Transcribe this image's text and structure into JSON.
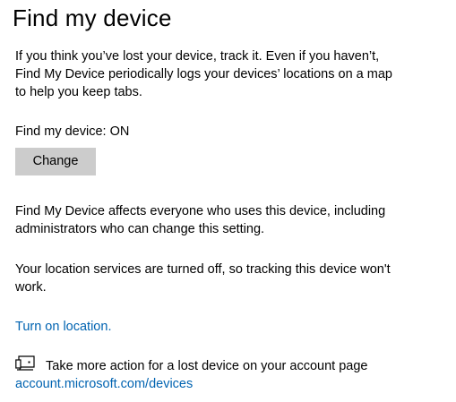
{
  "page": {
    "title": "Find my device"
  },
  "intro": {
    "lines": [
      "If you think you’ve lost your device, track it. Even if you haven’t,",
      "Find My Device periodically logs your devices’ locations on a map",
      "to help you keep tabs."
    ]
  },
  "status": {
    "text": "Find my device: ON"
  },
  "change_button": {
    "label": "Change"
  },
  "affects": {
    "lines": [
      "Find My Device affects everyone who uses this device, including",
      "administrators who can change this setting."
    ]
  },
  "location_warning": {
    "lines": [
      "Your location services are turned off, so tracking this device won't",
      "work."
    ]
  },
  "turn_on_location": {
    "label": "Turn on location."
  },
  "more_action": {
    "icon": "device-find-icon",
    "text": "Take more action for a lost device on your account page",
    "link_label": "account.microsoft.com/devices"
  },
  "colors": {
    "link": "#0063b1",
    "button_bg": "#cccccc",
    "text": "#000000",
    "background": "#ffffff"
  }
}
